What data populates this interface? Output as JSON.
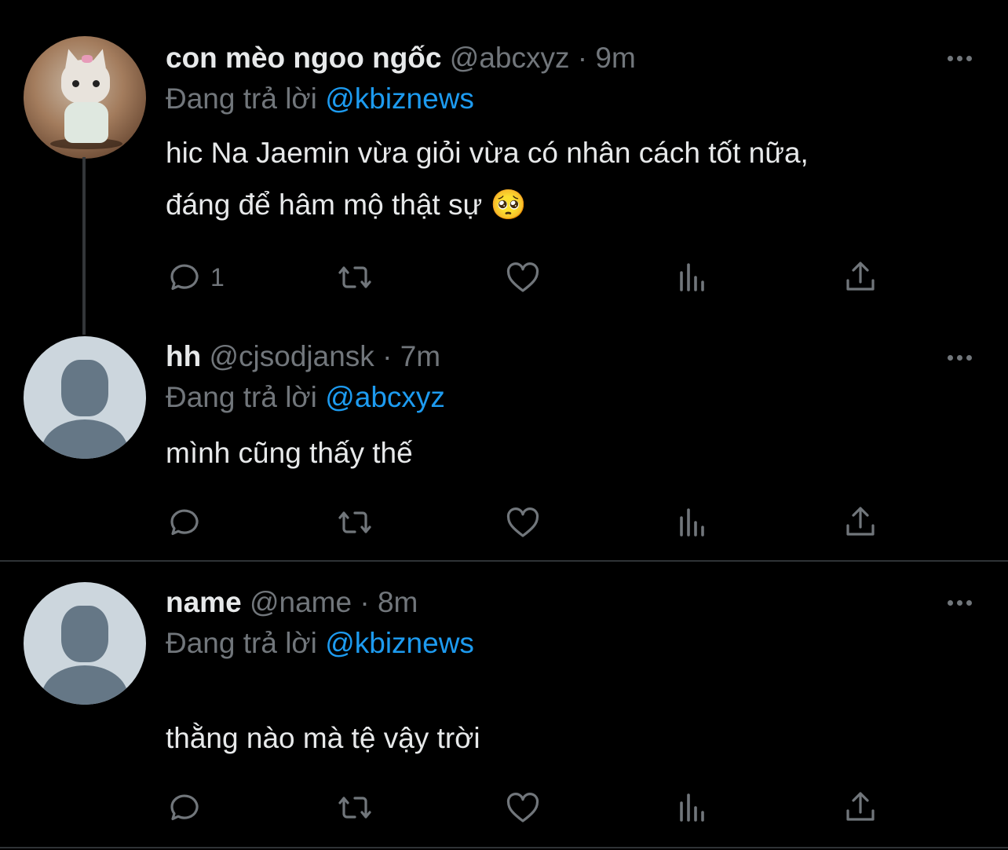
{
  "tweets": [
    {
      "name": "con mèo ngoo ngốc",
      "handle": "@abcxyz",
      "dot": "·",
      "time": "9m",
      "replying_prefix": "Đang trả lời",
      "replying_to": "@kbiznews",
      "text_line1": "hic Na Jaemin vừa giỏi vừa có nhân cách tốt nữa,",
      "text_line2": "đáng để hâm mộ thật sự 🥺",
      "reply_count": "1",
      "avatar": "cat-figurine-photo"
    },
    {
      "name": "hh",
      "handle": "@cjsodjansk",
      "dot": "·",
      "time": "7m",
      "replying_prefix": "Đang trả lời",
      "replying_to": "@abcxyz",
      "text_line1": "mình cũng thấy thế",
      "reply_count": "",
      "avatar": "default-avatar"
    },
    {
      "name": "name",
      "handle": "@name",
      "dot": "·",
      "time": "8m",
      "replying_prefix": "Đang trả lời",
      "replying_to": "@kbiznews",
      "text_line1": "thằng nào mà tệ vậy trời",
      "reply_count": "",
      "avatar": "default-avatar"
    }
  ],
  "icons": [
    "reply-icon",
    "retweet-icon",
    "like-icon",
    "analytics-icon",
    "share-icon",
    "more-icon"
  ],
  "colors": {
    "background": "#000000",
    "text": "#e7e9ea",
    "muted": "#71767b",
    "accent": "#1d9bf0"
  }
}
